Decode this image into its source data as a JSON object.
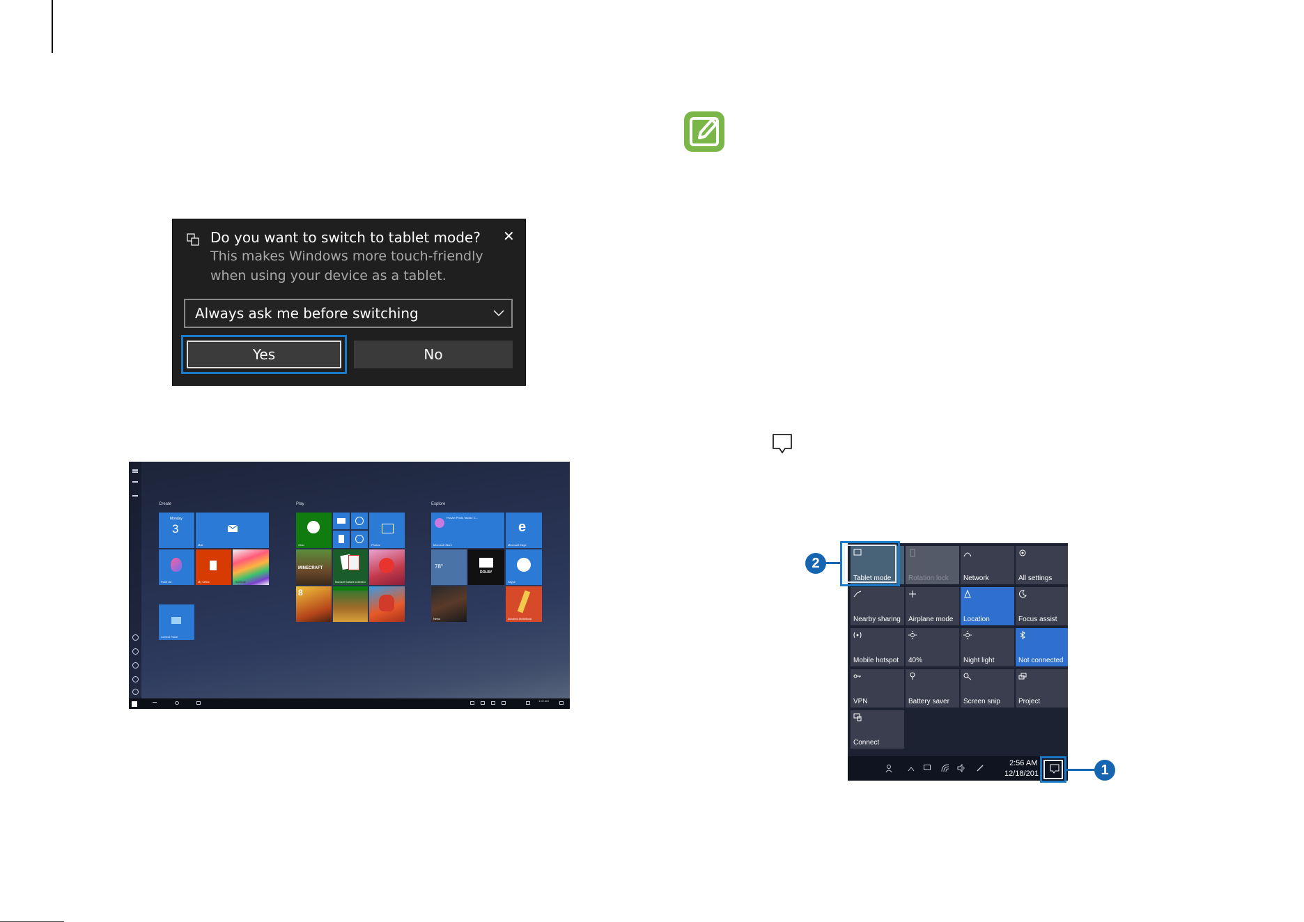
{
  "tablet_prompt": {
    "title": "Do you want to switch to tablet mode?",
    "body_line1": "This makes Windows more touch-friendly",
    "body_line2": "when using your device as a tablet.",
    "close_glyph": "✕",
    "dropdown_value": "Always ask me before switching",
    "yes_label": "Yes",
    "no_label": "No",
    "highlight_color": "#1a7ac8"
  },
  "start_screen": {
    "groups": [
      "Create",
      "Play",
      "Explore"
    ],
    "tiles": {
      "calendar_day": "Monday",
      "calendar_date": "3",
      "mail": "Mail",
      "paint3d": "Paint 3D",
      "my_office": "My Office",
      "onenote": "OneNote",
      "xbox": "Xbox",
      "photos": "Photos",
      "store": "Microsoft Store",
      "edge": "Microsoft Edge",
      "weather_temp": "78°",
      "skype": "Skype",
      "dolby": "DOLBY",
      "news": "News",
      "control_panel": "Control Panel",
      "solitaire": "Microsoft Solitaire Collection",
      "minecraft": "MINECRAFT",
      "photo_studio": "PicsArt Photo Studio: C...",
      "sketch": "Autodesk SketchBook"
    },
    "taskbar_time": "1:02 AM"
  },
  "action_center": {
    "tiles": [
      {
        "label": "Tablet mode",
        "state": "off"
      },
      {
        "label": "Rotation lock",
        "state": "disabled"
      },
      {
        "label": "Network",
        "state": "off"
      },
      {
        "label": "All settings",
        "state": "off"
      },
      {
        "label": "Nearby sharing",
        "state": "off"
      },
      {
        "label": "Airplane mode",
        "state": "off"
      },
      {
        "label": "Location",
        "state": "on"
      },
      {
        "label": "Focus assist",
        "state": "off"
      },
      {
        "label": "Mobile hotspot",
        "state": "off"
      },
      {
        "label": "40%",
        "state": "off"
      },
      {
        "label": "Night light",
        "state": "off"
      },
      {
        "label": "Not connected",
        "state": "on"
      },
      {
        "label": "VPN",
        "state": "off"
      },
      {
        "label": "Battery saver",
        "state": "off"
      },
      {
        "label": "Screen snip",
        "state": "off"
      },
      {
        "label": "Project",
        "state": "off"
      },
      {
        "label": "Connect",
        "state": "off"
      }
    ],
    "clock_time": "2:56 AM",
    "clock_date": "12/18/201",
    "on_color": "#2f6fce"
  },
  "callouts": {
    "one": "1",
    "two": "2",
    "color": "#1565b0"
  },
  "note_icon": {
    "color": "#7ab648"
  }
}
